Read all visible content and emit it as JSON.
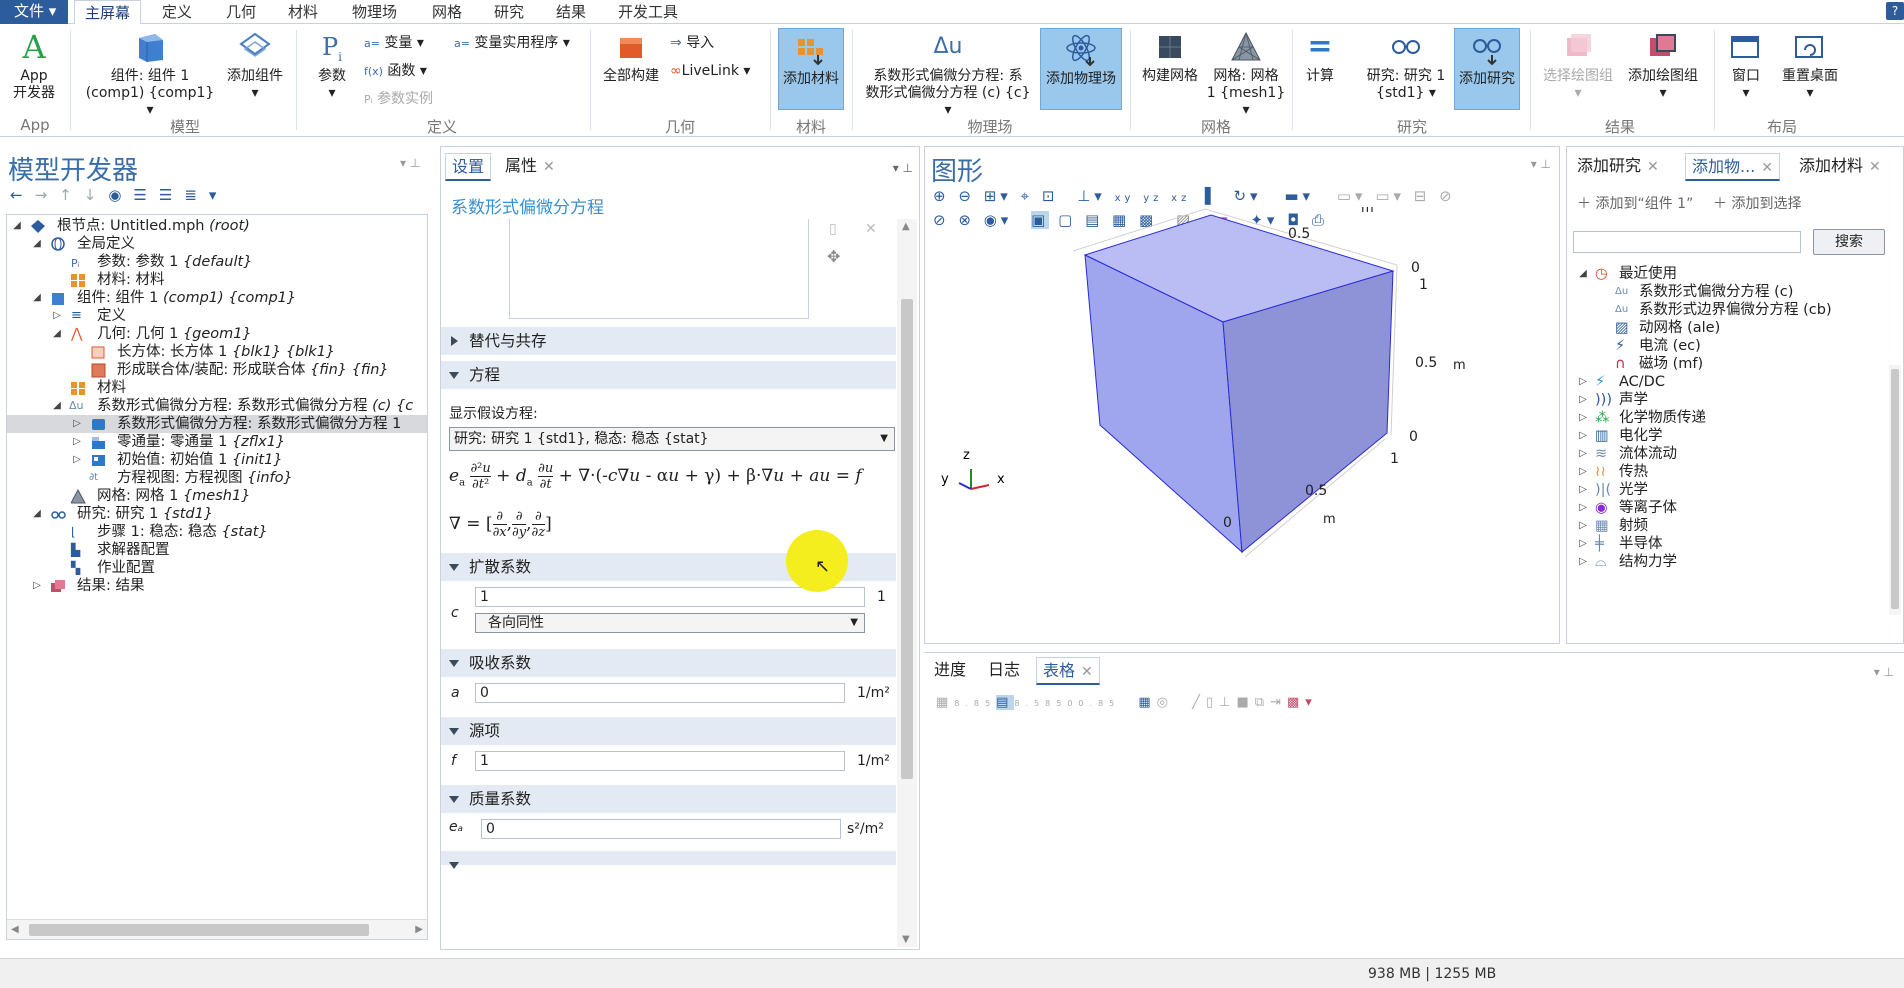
{
  "menu": {
    "file": "文件",
    "tabs": [
      "主屏幕",
      "定义",
      "几何",
      "材料",
      "物理场",
      "网格",
      "研究",
      "结果",
      "开发工具"
    ],
    "help": "?"
  },
  "ribbon": {
    "app_line1": "App",
    "app_line2": "开发器",
    "component_line1": "组件: 组件 1",
    "component_line2": "(comp1) {comp1}",
    "add_component": "添加组件",
    "parameters": "参数",
    "variables": "变量",
    "functions": "函数",
    "param_case": "参数实例",
    "var_utils": "变量实用程序",
    "build_all": "全部构建",
    "import": "导入",
    "livelink": "LiveLink",
    "add_material": "添加材料",
    "physics_line1": "系数形式偏微分方程: 系",
    "physics_line2": "数形式偏微分方程 (c) {c}",
    "add_physics": "添加物理场",
    "build_mesh": "构建网格",
    "mesh_line1": "网格: 网格",
    "mesh_line2": "1 {mesh1}",
    "compute": "计算",
    "study_line1": "研究: 研究 1",
    "study_line2": "{std1}",
    "add_study": "添加研究",
    "select_plot_group": "选择绘图组",
    "add_plot_group": "添加绘图组",
    "window": "窗口",
    "reset_desktop": "重置桌面",
    "groups": [
      "App",
      "模型",
      "定义",
      "几何",
      "材料",
      "物理场",
      "网格",
      "研究",
      "结果",
      "布局"
    ]
  },
  "model_builder": {
    "title": "模型开发器",
    "tree": [
      {
        "text": "根节点: Untitled.mph ",
        "tag": "(root)"
      },
      {
        "text": "全局定义",
        "tag": ""
      },
      {
        "text": "参数: 参数 1 ",
        "tag": "{default}"
      },
      {
        "text": "材料: 材料",
        "tag": ""
      },
      {
        "text": "组件: 组件 1 ",
        "tag": "(comp1) {comp1}"
      },
      {
        "text": "定义",
        "tag": ""
      },
      {
        "text": "几何: 几何 1 ",
        "tag": "{geom1}"
      },
      {
        "text": "长方体: 长方体 1 ",
        "tag": "{blk1} {blk1}"
      },
      {
        "text": "形成联合体/装配: 形成联合体 ",
        "tag": "{fin} {fin}"
      },
      {
        "text": "材料",
        "tag": ""
      },
      {
        "text": "系数形式偏微分方程: 系数形式偏微分方程 ",
        "tag": "(c) {c"
      },
      {
        "text": "系数形式偏微分方程: 系数形式偏微分方程 1",
        "tag": ""
      },
      {
        "text": "零通量: 零通量 1 ",
        "tag": "{zflx1}"
      },
      {
        "text": "初始值: 初始值 1 ",
        "tag": "{init1}"
      },
      {
        "text": "方程视图: 方程视图 ",
        "tag": "{info}"
      },
      {
        "text": "网格: 网格 1 ",
        "tag": "{mesh1}"
      },
      {
        "text": "研究: 研究 1 ",
        "tag": "{std1}"
      },
      {
        "text": "步骤 1: 稳态: 稳态 ",
        "tag": "{stat}"
      },
      {
        "text": "求解器配置",
        "tag": ""
      },
      {
        "text": "作业配置",
        "tag": ""
      },
      {
        "text": "结果: 结果",
        "tag": ""
      }
    ]
  },
  "settings": {
    "tabs": [
      "设置",
      "属性"
    ],
    "heading": "系数形式偏微分方程",
    "sec_override": "替代与共存",
    "sec_equation": "方程",
    "show_eq_label": "显示假设方程:",
    "show_eq_value": "研究: 研究 1 {std1}, 稳态: 稳态 {stat}",
    "sec_diffusion": "扩散系数",
    "c_label": "c",
    "c_value": "1",
    "c_unit": "1",
    "c_type": "各向同性",
    "sec_absorption": "吸收系数",
    "a_label": "a",
    "a_value": "0",
    "a_unit": "1/m²",
    "sec_source": "源项",
    "f_label": "f",
    "f_value": "1",
    "f_unit": "1/m²",
    "sec_mass": "质量系数",
    "ea_label": "eₐ",
    "ea_value": "0",
    "ea_unit": "s²/m²"
  },
  "graphics": {
    "title": "图形",
    "axis_labels": [
      "1",
      "0.5",
      "0",
      "1",
      "0.5",
      "0",
      "1",
      "0.5",
      "0"
    ],
    "unit": "m",
    "triad": [
      "z",
      "y",
      "x"
    ],
    "cube_fill": "#a8aef0",
    "cube_edge": "#2a2ad8"
  },
  "bottom": {
    "tabs": [
      "进度",
      "日志",
      "表格"
    ]
  },
  "add_physics": {
    "tabs": [
      "添加研究",
      "添加物...",
      "添加材料"
    ],
    "add_to": "添加到“组件 1”",
    "add_selection": "添加到选择",
    "search_placeholder": "",
    "search_btn": "搜索",
    "recent": "最近使用",
    "recent_items": [
      "系数形式偏微分方程 (c)",
      "系数形式边界偏微分方程 (cb)",
      "动网格 (ale)",
      "电流 (ec)",
      "磁场 (mf)"
    ],
    "categories": [
      "AC/DC",
      "声学",
      "化学物质传递",
      "电化学",
      "流体流动",
      "传热",
      "光学",
      "等离子体",
      "射频",
      "半导体",
      "结构力学"
    ]
  },
  "status": {
    "memory": "938 MB | 1255 MB"
  }
}
